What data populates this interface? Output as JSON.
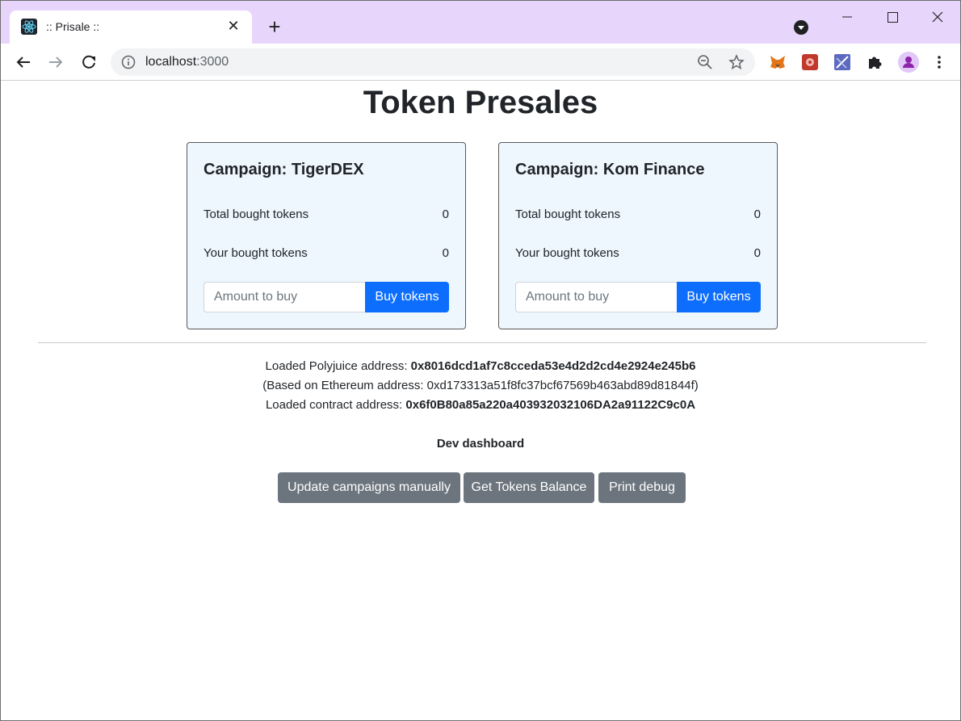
{
  "browser": {
    "tab_title": ":: Prisale ::",
    "tab_close": "✕",
    "new_tab": "+",
    "url_host": "localhost",
    "url_port": ":3000"
  },
  "page": {
    "heading": "Token Presales",
    "campaigns": [
      {
        "title": "Campaign: TigerDEX",
        "total_label": "Total bought tokens",
        "total_value": "0",
        "your_label": "Your bought tokens",
        "your_value": "0",
        "input_placeholder": "Amount to buy",
        "buy_label": "Buy tokens"
      },
      {
        "title": "Campaign: Kom Finance",
        "total_label": "Total bought tokens",
        "total_value": "0",
        "your_label": "Your bought tokens",
        "your_value": "0",
        "input_placeholder": "Amount to buy",
        "buy_label": "Buy tokens"
      }
    ],
    "polyjuice_label": "Loaded Polyjuice address: ",
    "polyjuice_address": "0x8016dcd1af7c8cceda53e4d2d2cd4e2924e245b6",
    "eth_based_text": "(Based on Ethereum address: 0xd173313a51f8fc37bcf67569b463abd89d81844f)",
    "contract_label": "Loaded contract address: ",
    "contract_address": "0x6f0B80a85a220a403932032106DA2a91122C9c0A",
    "dev_title": "Dev dashboard",
    "dev_buttons": {
      "update": "Update campaigns manually",
      "balance": "Get Tokens Balance",
      "debug": "Print debug"
    }
  },
  "colors": {
    "tabstrip": "#e8d5fb",
    "primary": "#0d6efd",
    "secondary": "#6c757d",
    "card_bg": "#eef6fe"
  }
}
